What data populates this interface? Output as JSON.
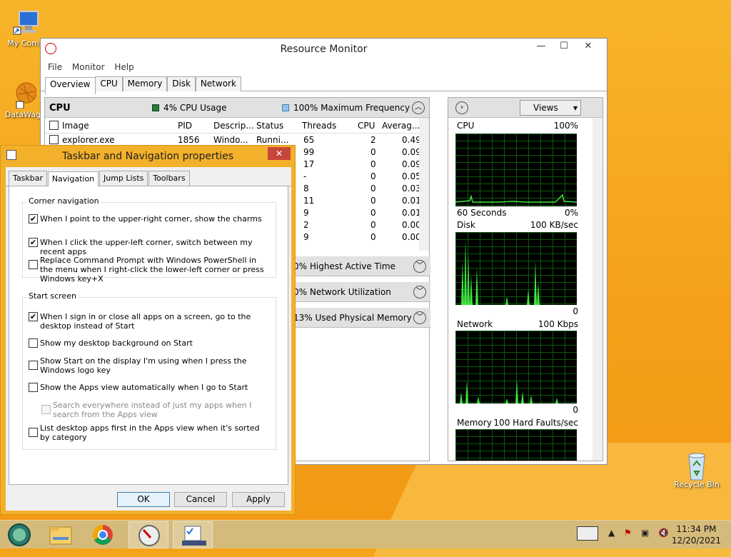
{
  "desktop": {
    "icons": [
      {
        "label": "My Comp"
      },
      {
        "label": "DataWag"
      },
      {
        "label": "Recycle Bin"
      }
    ]
  },
  "resource_monitor": {
    "title": "Resource Monitor",
    "menu": [
      "File",
      "Monitor",
      "Help"
    ],
    "tabs": [
      "Overview",
      "CPU",
      "Memory",
      "Disk",
      "Network"
    ],
    "cpu_section": {
      "title": "CPU",
      "usage": "4% CPU Usage",
      "frequency": "100% Maximum Frequency",
      "columns": [
        "Image",
        "PID",
        "Descrip...",
        "Status",
        "Threads",
        "CPU",
        "Averag..."
      ],
      "rows": [
        {
          "image": "explorer.exe",
          "pid": "1856",
          "desc": "Windo...",
          "status": "Runni...",
          "threads": "65",
          "cpu": "2",
          "avg": "0.49"
        },
        {
          "threads": "99",
          "cpu": "0",
          "avg": "0.09"
        },
        {
          "threads": "17",
          "cpu": "0",
          "avg": "0.09"
        },
        {
          "threads": "-",
          "cpu": "0",
          "avg": "0.05"
        },
        {
          "threads": "8",
          "cpu": "0",
          "avg": "0.03"
        },
        {
          "threads": "11",
          "cpu": "0",
          "avg": "0.01"
        },
        {
          "threads": "9",
          "cpu": "0",
          "avg": "0.01"
        },
        {
          "threads": "2",
          "cpu": "0",
          "avg": "0.00"
        },
        {
          "threads": "9",
          "cpu": "0",
          "avg": "0.00"
        }
      ]
    },
    "collapsed_sections": [
      "0% Highest Active Time",
      "0% Network Utilization",
      "13% Used Physical Memory"
    ],
    "views_label": "Views",
    "graphs": [
      {
        "name": "CPU",
        "max": "100%",
        "footer_left": "60 Seconds",
        "footer_right": "0%"
      },
      {
        "name": "Disk",
        "max": "100 KB/sec",
        "footer_right": "0"
      },
      {
        "name": "Network",
        "max": "100 Kbps",
        "footer_right": "0"
      },
      {
        "name": "Memory",
        "max": "100 Hard Faults/sec"
      }
    ]
  },
  "dialog": {
    "title": "Taskbar and Navigation properties",
    "close": "✕",
    "tabs": [
      "Taskbar",
      "Navigation",
      "Jump Lists",
      "Toolbars"
    ],
    "corner_nav": {
      "title": "Corner navigation",
      "options": [
        {
          "label": "When I point to the upper-right corner, show the charms",
          "checked": true
        },
        {
          "label": "When I click the upper-left corner, switch between my recent apps",
          "checked": true
        },
        {
          "label": "Replace Command Prompt with Windows PowerShell in the menu when I right-click the lower-left corner or press Windows key+X",
          "checked": false
        }
      ]
    },
    "start_screen": {
      "title": "Start screen",
      "options": [
        {
          "label": "When I sign in or close all apps on a screen, go to the desktop instead of Start",
          "checked": true
        },
        {
          "label": "Show my desktop background on Start",
          "checked": false
        },
        {
          "label": "Show Start on the display I'm using when I press the Windows logo key",
          "checked": false
        },
        {
          "label": "Show the Apps view automatically when I go to Start",
          "checked": false
        },
        {
          "label": "Search everywhere instead of just my apps when I search from the Apps view",
          "checked": false,
          "disabled": true
        },
        {
          "label": "List desktop apps first in the Apps view when it's sorted by category",
          "checked": false
        }
      ]
    },
    "buttons": {
      "ok": "OK",
      "cancel": "Cancel",
      "apply": "Apply"
    }
  },
  "taskbar": {
    "time": "11:34 PM",
    "date": "12/20/2021"
  }
}
